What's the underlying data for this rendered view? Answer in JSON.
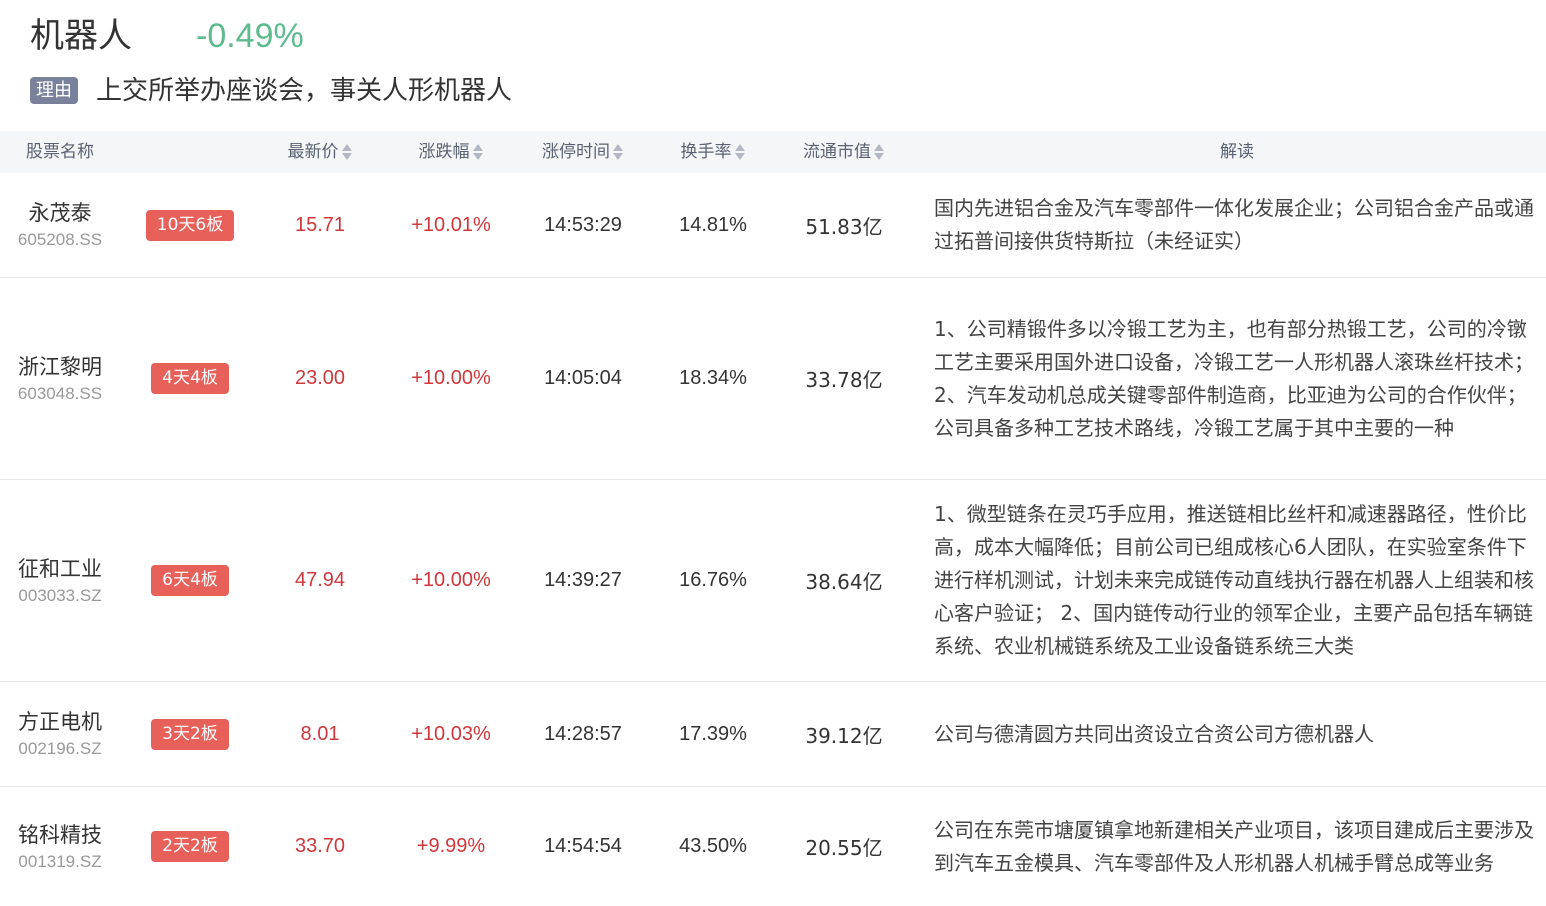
{
  "sector": {
    "title": "机器人",
    "change": "-0.49%",
    "change_color": "#5dbb8f",
    "reason_tag": "理由",
    "reason_text": "上交所举办座谈会，事关人形机器人"
  },
  "columns": {
    "name": "股票名称",
    "price": "最新价",
    "change": "涨跌幅",
    "limit_time": "涨停时间",
    "turnover": "换手率",
    "market_cap": "流通市值",
    "analysis": "解读"
  },
  "rows": [
    {
      "name": "永茂泰",
      "code": "605208.SS",
      "streak": "10天6板",
      "price": "15.71",
      "change": "+10.01%",
      "limit_time": "14:53:29",
      "turnover": "14.81%",
      "market_cap": "51.83亿",
      "analysis": "国内先进铝合金及汽车零部件一体化发展企业；公司铝合金产品或通过拓普间接供货特斯拉（未经证实）"
    },
    {
      "name": "浙江黎明",
      "code": "603048.SS",
      "streak": "4天4板",
      "price": "23.00",
      "change": "+10.00%",
      "limit_time": "14:05:04",
      "turnover": "18.34%",
      "market_cap": "33.78亿",
      "analysis": "1、公司精锻件多以冷锻工艺为主，也有部分热锻工艺，公司的冷镦工艺主要采用国外进口设备，冷锻工艺一人形机器人滚珠丝杆技术； 2、汽车发动机总成关键零部件制造商，比亚迪为公司的合作伙伴；公司具备多种工艺技术路线，冷锻工艺属于其中主要的一种"
    },
    {
      "name": "征和工业",
      "code": "003033.SZ",
      "streak": "6天4板",
      "price": "47.94",
      "change": "+10.00%",
      "limit_time": "14:39:27",
      "turnover": "16.76%",
      "market_cap": "38.64亿",
      "analysis": "1、微型链条在灵巧手应用，推送链相比丝杆和减速器路径，性价比高，成本大幅降低；目前公司已组成核心6人团队，在实验室条件下进行样机测试，计划未来完成链传动直线执行器在机器人上组装和核心客户验证； 2、国内链传动行业的领军企业，主要产品包括车辆链系统、农业机械链系统及工业设备链系统三大类"
    },
    {
      "name": "方正电机",
      "code": "002196.SZ",
      "streak": "3天2板",
      "price": "8.01",
      "change": "+10.03%",
      "limit_time": "14:28:57",
      "turnover": "17.39%",
      "market_cap": "39.12亿",
      "analysis": "公司与德清圆方共同出资设立合资公司方德机器人"
    },
    {
      "name": "铭科精技",
      "code": "001319.SZ",
      "streak": "2天2板",
      "price": "33.70",
      "change": "+9.99%",
      "limit_time": "14:54:54",
      "turnover": "43.50%",
      "market_cap": "20.55亿",
      "analysis": "公司在东莞市塘厦镇拿地新建相关产业项目，该项目建成后主要涉及到汽车五金模具、汽车零部件及人形机器人机械手臂总成等业务"
    }
  ]
}
